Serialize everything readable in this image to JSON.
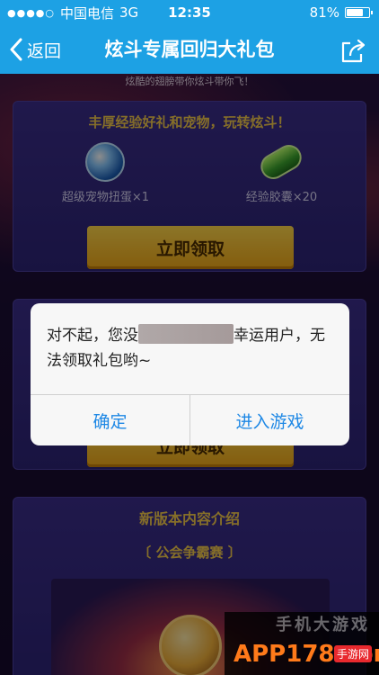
{
  "status_bar": {
    "carrier": "中国电信",
    "network": "3G",
    "time": "12:35",
    "battery": "81%",
    "battery_level": 0.81
  },
  "nav": {
    "back_label": "返回",
    "title": "炫斗专属回归大礼包"
  },
  "page": {
    "tagline": "炫酷的翅膀带你炫斗带你飞！",
    "panel1": {
      "header": "丰厚经验好礼和宠物，玩转炫斗！",
      "gifts": [
        {
          "label": "超级宠物扭蛋×1",
          "icon": "pet-egg-icon"
        },
        {
          "label": "经验胶囊×20",
          "icon": "exp-capsule-icon"
        }
      ],
      "claim_label": "立即领取"
    },
    "panel2": {
      "claim_label": "立即领取"
    },
    "panel3": {
      "section_title": "新版本内容介绍",
      "sub_title": "〔 公会争霸赛 〕"
    }
  },
  "dialog": {
    "message_before": "对不起，您没",
    "message_after": "幸运用户，无法领取礼包哟~",
    "confirm_label": "确定",
    "enter_game_label": "进入游戏"
  },
  "watermark": {
    "top_text": "手机大游戏",
    "brand": "APP178.com",
    "badge": "手游网"
  },
  "colors": {
    "nav_blue": "#1da1e4",
    "gold": "#f2c94c",
    "dialog_button_blue": "#1e88e5"
  }
}
